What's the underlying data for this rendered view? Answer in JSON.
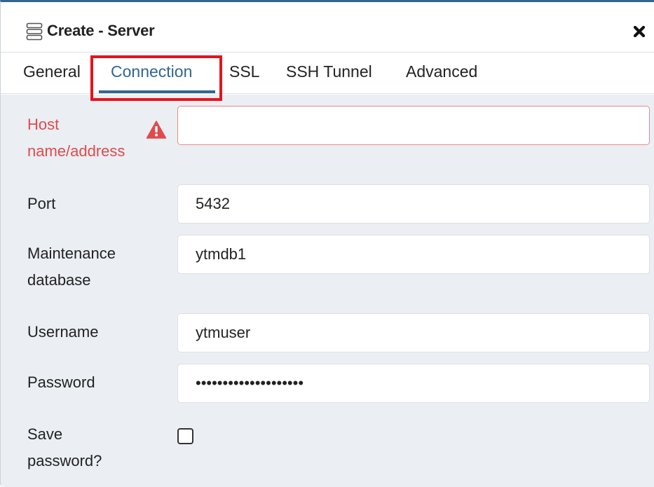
{
  "dialog": {
    "title": "Create - Server",
    "close_symbol": "✖",
    "icons": {
      "title": "server-icon",
      "close": "close-icon"
    }
  },
  "tabs": [
    {
      "label": "General",
      "active": false
    },
    {
      "label": "Connection",
      "active": true
    },
    {
      "label": "SSL",
      "active": false
    },
    {
      "label": "SSH Tunnel",
      "active": false
    },
    {
      "label": "Advanced",
      "active": false
    }
  ],
  "form": {
    "host": {
      "label_line1": "Host",
      "label_line2": "name/address",
      "value": "",
      "status": "error",
      "status_icon": "warning-icon"
    },
    "port": {
      "label": "Port",
      "value": "5432"
    },
    "maintenance_db": {
      "label_line1": "Maintenance",
      "label_line2": "database",
      "value": "ytmdb1"
    },
    "username": {
      "label": "Username",
      "value": "ytmuser"
    },
    "password": {
      "label": "Password",
      "value": "••••••••••••••••••••"
    },
    "save_password": {
      "label_line1": "Save",
      "label_line2": "password?",
      "checked": false
    }
  },
  "colors": {
    "accent": "#326690",
    "error": "#e04b4b",
    "highlight": "#e8121a",
    "form_background": "#ebeef3"
  }
}
